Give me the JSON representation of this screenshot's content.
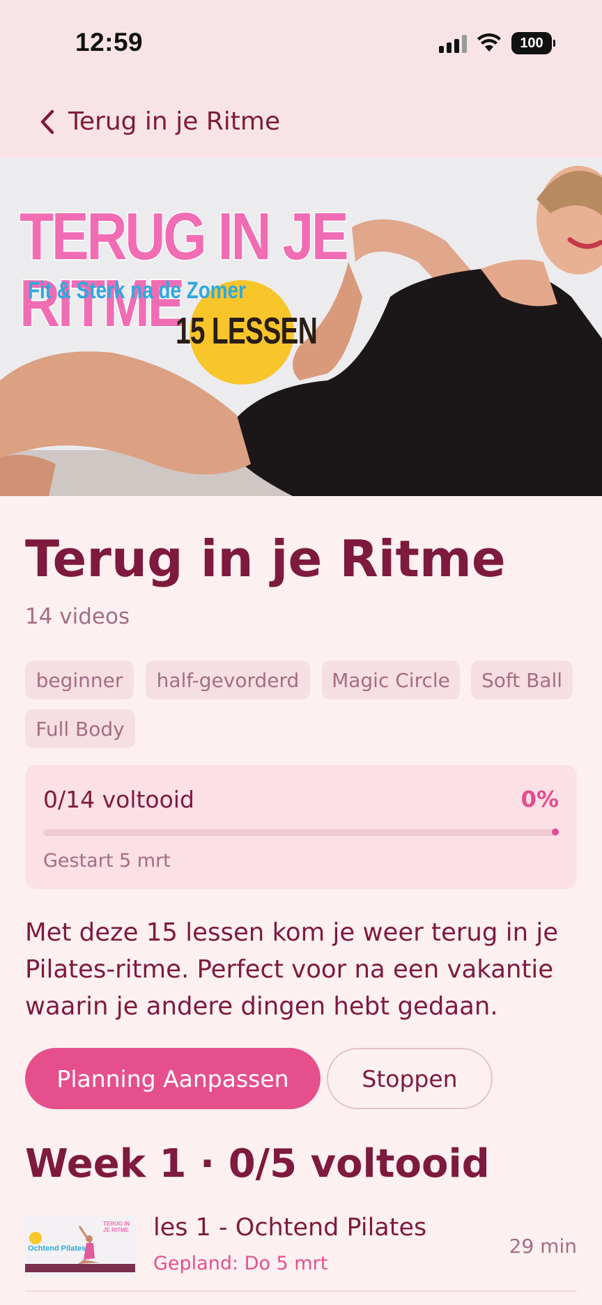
{
  "status_bar": {
    "time": "12:59",
    "battery": "100"
  },
  "nav": {
    "back_label": "Terug in je Ritme"
  },
  "hero": {
    "title": "TERUG IN JE RITME",
    "subtitle": "Fit & Sterk na de Zomer",
    "lessons": "15 LESSEN"
  },
  "program": {
    "title": "Terug in je Ritme",
    "video_count": "14 videos",
    "tags": [
      "beginner",
      "half-gevorderd",
      "Magic Circle",
      "Soft Ball",
      "Full Body"
    ],
    "progress": {
      "label": "0/14 voltooid",
      "percent_text": "0%",
      "fraction": 0,
      "started": "Gestart 5 mrt"
    },
    "description": "Met deze 15 lessen kom je weer terug in je Pilates-ritme. Perfect voor na een vakantie waarin je andere dingen hebt gedaan.",
    "primary_button": "Planning Aanpassen",
    "secondary_button": "Stoppen"
  },
  "week": {
    "heading": "Week 1 · 0/5 voltooid",
    "lessons": [
      {
        "title": "les 1 - Ochtend Pilates",
        "planned": "Gepland: Do 5 mrt",
        "duration": "29 min",
        "thumb_title": "TERUG IN JE RITME",
        "thumb_label": "Ochtend Pilates"
      }
    ]
  },
  "colors": {
    "accent": "#e5508c",
    "text": "#7d1a3d",
    "muted": "#a46d84",
    "background": "#fcf0f1"
  }
}
